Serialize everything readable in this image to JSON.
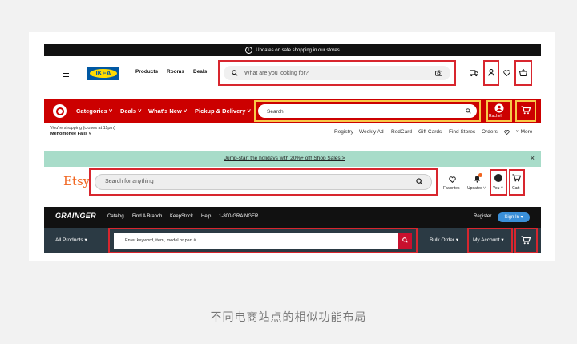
{
  "ikea": {
    "banner": "Updates on safe shopping in our stores",
    "logo": "IKEA",
    "nav": [
      "Products",
      "Rooms",
      "Deals"
    ],
    "search_placeholder": "What are you looking for?",
    "icons": [
      "truck-icon",
      "account-icon",
      "heart-icon",
      "basket-icon"
    ]
  },
  "target": {
    "nav": [
      "Categories",
      "Deals",
      "What's New",
      "Pickup & Delivery"
    ],
    "search_placeholder": "Search",
    "account_label": "Rachel",
    "store_line1": "You're shopping (closes at 11pm)",
    "store_line2": "Menomonee Falls",
    "links": [
      "Registry",
      "Weekly Ad",
      "RedCard",
      "Gift Cards",
      "Find Stores",
      "Orders",
      "More"
    ]
  },
  "etsy": {
    "banner": "Jump-start the holidays with 20%+ off! Shop Sales >",
    "logo": "Etsy",
    "search_placeholder": "Search for anything",
    "icon_labels": [
      "Favorites",
      "Updates",
      "You",
      "Cart"
    ]
  },
  "grainger": {
    "logo": "GRAINGER",
    "nav": [
      "Catalog",
      "Find A Branch",
      "KeepStock",
      "Help",
      "1-800-GRAINGER"
    ],
    "register": "Register",
    "signin": "Sign In",
    "all_products": "All Products",
    "search_placeholder": "Enter keyword, item, model or part #",
    "bulk_order": "Bulk Order",
    "my_account": "My Account"
  },
  "caption": "不同电商站点的相似功能布局",
  "colors": {
    "highlight": "#d8262e",
    "target_red": "#cc0000",
    "target_highlight": "#f7c948",
    "etsy_orange": "#f1641e",
    "ikea_blue": "#0058a3",
    "ikea_yellow": "#ffdb00",
    "grainger_blue": "#3a8fd8"
  }
}
